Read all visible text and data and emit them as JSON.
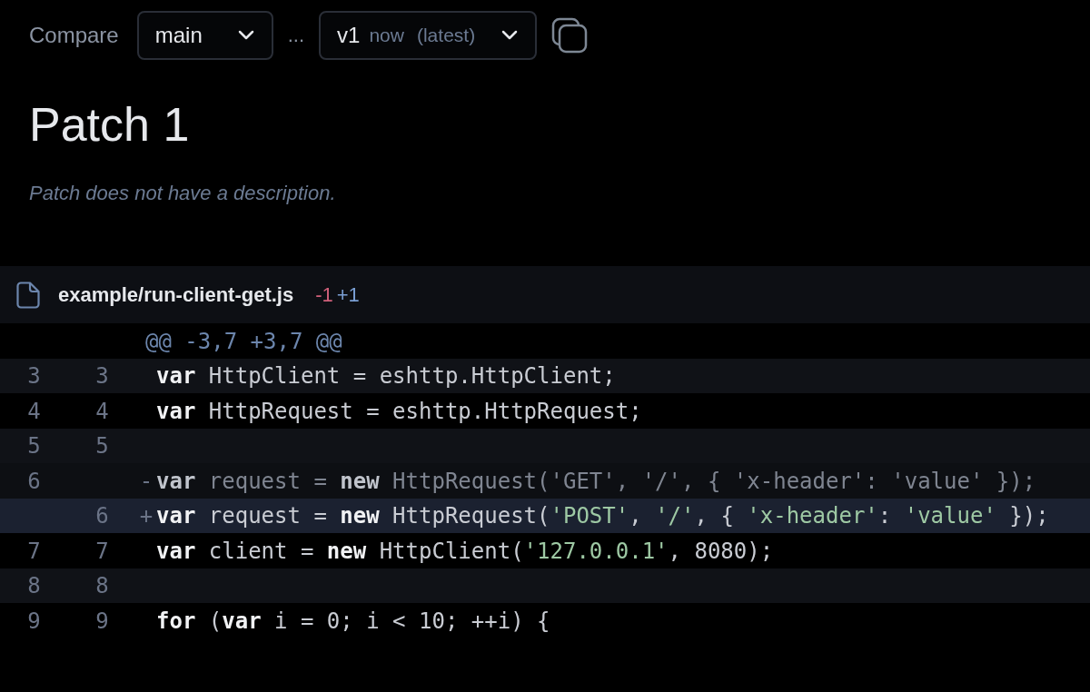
{
  "compare": {
    "label": "Compare",
    "base": {
      "value": "main"
    },
    "separator": "...",
    "head": {
      "version": "v1",
      "time": "now",
      "tag": "(latest)"
    }
  },
  "patch": {
    "title": "Patch 1",
    "description": "Patch does not have a description."
  },
  "file": {
    "path": "example/run-client-get.js",
    "removed": "-1",
    "added": "+1",
    "hunk": "@@ -3,7 +3,7 @@",
    "lines": [
      {
        "kind": "context",
        "old": "3",
        "new": "3",
        "tokens": [
          {
            "kind": "kw",
            "text": "var"
          },
          {
            "kind": "plain",
            "text": " HttpClient = eshttp.HttpClient;"
          }
        ]
      },
      {
        "kind": "context",
        "old": "4",
        "new": "4",
        "tokens": [
          {
            "kind": "kw",
            "text": "var"
          },
          {
            "kind": "plain",
            "text": " HttpRequest = eshttp.HttpRequest;"
          }
        ]
      },
      {
        "kind": "context",
        "old": "5",
        "new": "5"
      },
      {
        "kind": "removed",
        "old": "6",
        "sign": "-",
        "tokens": [
          {
            "kind": "kw",
            "text": "var"
          },
          {
            "kind": "plain",
            "text": " request = "
          },
          {
            "kind": "kw",
            "text": "new"
          },
          {
            "kind": "plain",
            "text": " HttpRequest("
          },
          {
            "kind": "str",
            "text": "'GET'"
          },
          {
            "kind": "plain",
            "text": ", "
          },
          {
            "kind": "str",
            "text": "'/'"
          },
          {
            "kind": "plain",
            "text": ", { "
          },
          {
            "kind": "str",
            "text": "'x-header'"
          },
          {
            "kind": "plain",
            "text": ": "
          },
          {
            "kind": "str",
            "text": "'value'"
          },
          {
            "kind": "plain",
            "text": " });"
          }
        ]
      },
      {
        "kind": "added",
        "new": "6",
        "sign": "+",
        "tokens": [
          {
            "kind": "kw",
            "text": "var"
          },
          {
            "kind": "plain",
            "text": " request = "
          },
          {
            "kind": "kw",
            "text": "new"
          },
          {
            "kind": "plain",
            "text": " HttpRequest("
          },
          {
            "kind": "str",
            "text": "'POST'"
          },
          {
            "kind": "plain",
            "text": ", "
          },
          {
            "kind": "str",
            "text": "'/'"
          },
          {
            "kind": "plain",
            "text": ", { "
          },
          {
            "kind": "str",
            "text": "'x-header'"
          },
          {
            "kind": "plain",
            "text": ": "
          },
          {
            "kind": "str",
            "text": "'value'"
          },
          {
            "kind": "plain",
            "text": " });"
          }
        ]
      },
      {
        "kind": "context",
        "old": "7",
        "new": "7",
        "tokens": [
          {
            "kind": "kw",
            "text": "var"
          },
          {
            "kind": "plain",
            "text": " client = "
          },
          {
            "kind": "kw",
            "text": "new"
          },
          {
            "kind": "plain",
            "text": " HttpClient("
          },
          {
            "kind": "str",
            "text": "'127.0.0.1'"
          },
          {
            "kind": "plain",
            "text": ", 8080);"
          }
        ]
      },
      {
        "kind": "context",
        "old": "8",
        "new": "8"
      },
      {
        "kind": "context",
        "old": "9",
        "new": "9",
        "tokens": [
          {
            "kind": "kw",
            "text": "for"
          },
          {
            "kind": "plain",
            "text": " ("
          },
          {
            "kind": "kw",
            "text": "var"
          },
          {
            "kind": "plain",
            "text": " i = 0; i < 10; ++i) {"
          }
        ]
      }
    ]
  }
}
